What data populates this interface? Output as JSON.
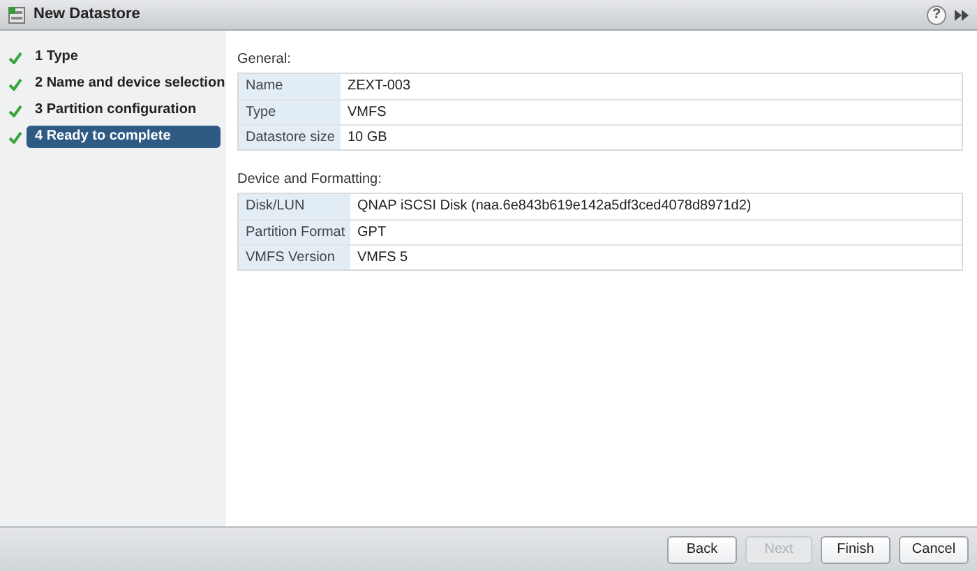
{
  "window": {
    "title": "New Datastore",
    "help": "?"
  },
  "steps": [
    {
      "label": "1 Type",
      "completed": true,
      "selected": false
    },
    {
      "label": "2 Name and device selection",
      "completed": true,
      "selected": false
    },
    {
      "label": "3 Partition configuration",
      "completed": true,
      "selected": false
    },
    {
      "label": "4 Ready to complete",
      "completed": true,
      "selected": true
    }
  ],
  "sections": [
    {
      "title": "General:",
      "rows": [
        {
          "label": "Name",
          "value": "ZEXT-003"
        },
        {
          "label": "Type",
          "value": "VMFS"
        },
        {
          "label": "Datastore size",
          "value": "10 GB"
        }
      ]
    },
    {
      "title": "Device and Formatting:",
      "rows": [
        {
          "label": "Disk/LUN",
          "value": "QNAP iSCSI Disk (naa.6e843b619e142a5df3ced4078d8971d2)"
        },
        {
          "label": "Partition Format",
          "value": "GPT"
        },
        {
          "label": "VMFS Version",
          "value": "VMFS 5"
        }
      ]
    }
  ],
  "buttons": [
    {
      "label": "Back",
      "disabled": false
    },
    {
      "label": "Next",
      "disabled": true
    },
    {
      "label": "Finish",
      "disabled": false
    },
    {
      "label": "Cancel",
      "disabled": false
    }
  ]
}
